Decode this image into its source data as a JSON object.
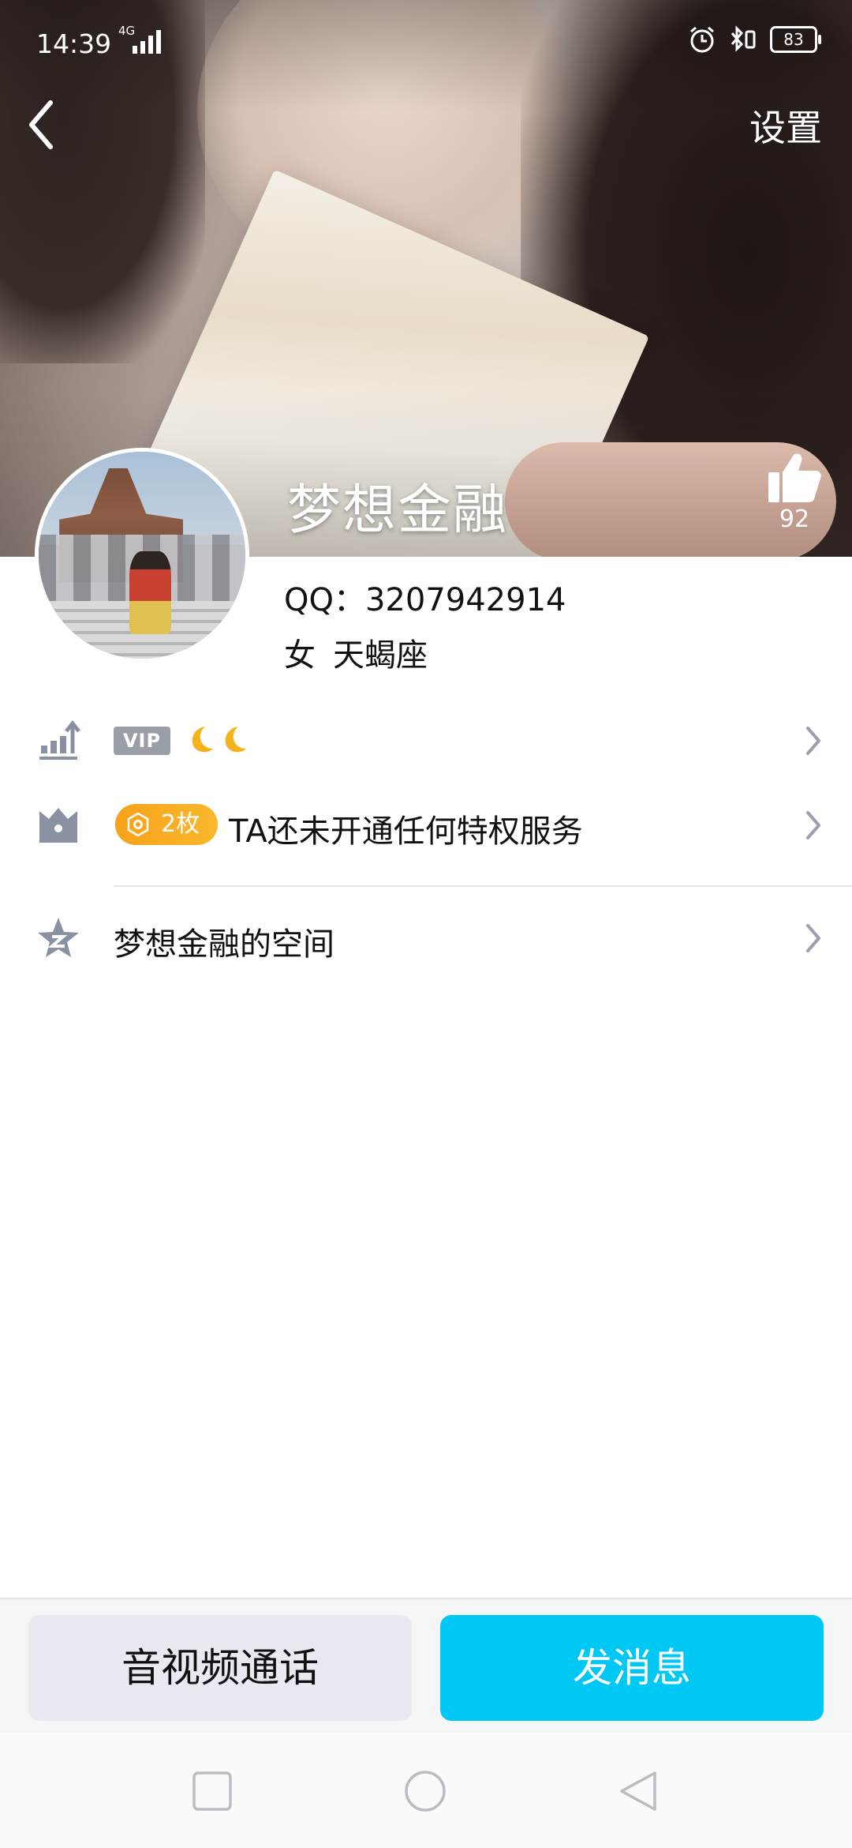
{
  "status_bar": {
    "time": "14:39",
    "network": "4G",
    "battery": "83"
  },
  "header": {
    "settings_label": "设置"
  },
  "profile": {
    "nickname": "梦想金融",
    "likes_count": "92",
    "qq_label": "QQ：",
    "qq_number": "3207942914",
    "gender": "女",
    "zodiac": "天蝎座"
  },
  "rows": {
    "level": {
      "vip_badge": "VIP",
      "moons": 2
    },
    "privilege": {
      "coin_count": "2枚",
      "text": "TA还未开通任何特权服务"
    },
    "space": {
      "text": "梦想金融的空间"
    }
  },
  "actions": {
    "call_label": "音视频通话",
    "message_label": "发消息"
  },
  "colors": {
    "accent": "#00c8f5",
    "coin": "#f7a21b",
    "icon_gray": "#8a91a3"
  },
  "icons": {
    "back": "chevron-left-icon",
    "like": "thumbs-up-icon",
    "level": "level-up-icon",
    "privilege": "crown-icon",
    "space": "star-z-icon",
    "chevron": "chevron-right-icon"
  }
}
